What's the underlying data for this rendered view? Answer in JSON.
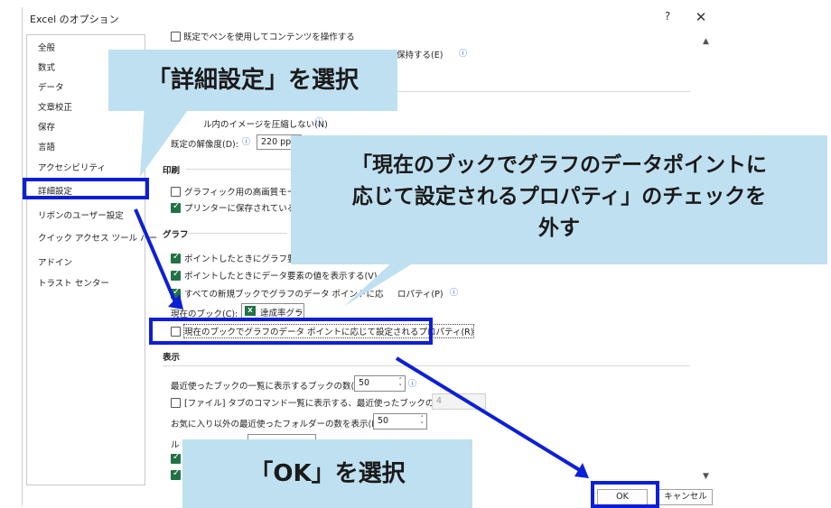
{
  "window": {
    "title": "Excel のオプション",
    "help_label": "?",
    "close_label": "✕"
  },
  "nav": {
    "items": [
      {
        "label": "全般"
      },
      {
        "label": "数式"
      },
      {
        "label": "データ"
      },
      {
        "label": "文章校正"
      },
      {
        "label": "保存"
      },
      {
        "label": "言語"
      },
      {
        "label": "アクセシビリティ"
      },
      {
        "label": "詳細設定"
      },
      {
        "label": "リボンのユーザー設定"
      },
      {
        "label": "クイック アクセス ツール バー"
      },
      {
        "label": "アドイン"
      },
      {
        "label": "トラスト センター"
      }
    ],
    "selected": "詳細設定"
  },
  "main": {
    "top_partial_1": "既定でペンを使用してコンテンツを操作する",
    "top_partial_2": "ャを保持する(E)",
    "image": {
      "compress_label": "ル内のイメージを圧縮しない(N)",
      "resolution_label": "既定の解像度(D):",
      "resolution_value": "220 ppi"
    },
    "print": {
      "header": "印刷",
      "hq_graphics_label": "グラフィック用の高画質モード(G)",
      "printer_label": "プリンターに保存されているフォ"
    },
    "graph": {
      "header": "グラフ",
      "item1_label": "ポイントしたときにグラフ要素名",
      "item2_label": "ポイントしたときにデータ要素の値を表示する(V)",
      "item3_label": "すべての新規ブックでグラフのデータ ポイントに応",
      "item3_tail": "ロパティ(P)",
      "current_book_label": "現在のブック(C):",
      "current_book_value": "達成率グラフ…",
      "current_book_prop_label": "現在のブックでグラフのデータ ポイントに応じて設定されるプロパティ(R)"
    },
    "display": {
      "header": "表示",
      "recent_books_label": "最近使ったブックの一覧に表示するブックの数(R):",
      "recent_books_value": "50",
      "file_tab_label": "[ファイル] タブのコマンド一覧に表示する、最近使ったブックの数(Q):",
      "file_tab_value": "4",
      "recent_folders_label": "お気に入り以外の最近使ったフォルダーの数を表示(F):",
      "recent_folders_value": "50",
      "ruler_label": "ル"
    }
  },
  "buttons": {
    "ok": "OK",
    "cancel": "キャンセル"
  },
  "callouts": {
    "detail": "「詳細設定」を選択",
    "uncheck_line1": "「現在のブックでグラフのデータポイントに",
    "uncheck_line2": "応じて設定されるプロパティ」のチェックを",
    "uncheck_line3": "外す",
    "ok": "「OK」を選択"
  },
  "colors": {
    "callout_bg": "#bfe0f0",
    "highlight": "#0d1fd6",
    "check_green": "#217346"
  },
  "icons": {
    "excel": "excel-icon",
    "info": "info-icon"
  }
}
